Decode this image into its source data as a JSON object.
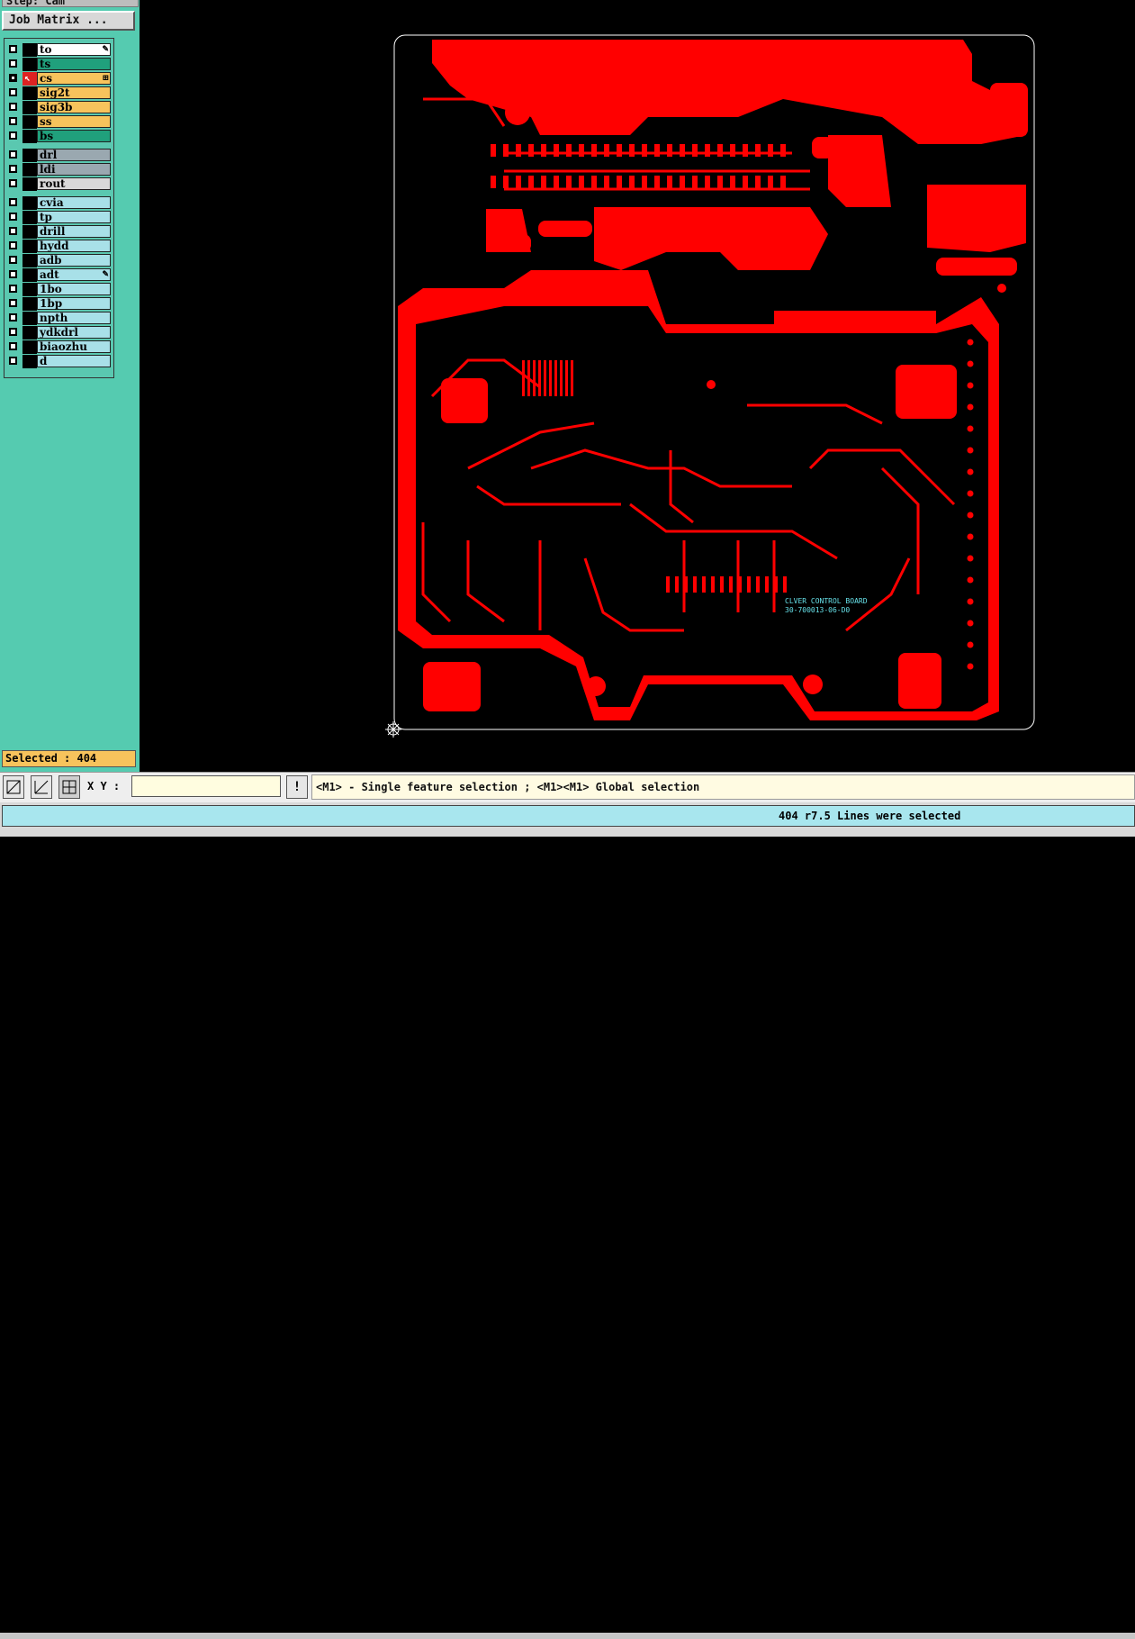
{
  "window": {
    "step_title": "Step: Cam",
    "job_matrix_label": "Job Matrix ..."
  },
  "layers": [
    {
      "name": "to",
      "color": "#ffffff",
      "flag": "✎",
      "checked": false,
      "marker": "none"
    },
    {
      "name": "ts",
      "color": "#20a07c",
      "flag": "",
      "checked": false,
      "marker": "none"
    },
    {
      "name": "cs",
      "color": "#f7c35c",
      "flag": "⊞",
      "checked": true,
      "marker": "arrow"
    },
    {
      "name": "sig2t",
      "color": "#f7c35c",
      "flag": "",
      "checked": false,
      "marker": "none"
    },
    {
      "name": "sig3b",
      "color": "#f7c35c",
      "flag": "",
      "checked": false,
      "marker": "none"
    },
    {
      "name": "ss",
      "color": "#f7c35c",
      "flag": "",
      "checked": false,
      "marker": "none"
    },
    {
      "name": "bs",
      "color": "#20a07c",
      "flag": "",
      "checked": false,
      "marker": "none"
    },
    {
      "name": "drl",
      "color": "#9aa8b0",
      "flag": "",
      "checked": false,
      "marker": "none"
    },
    {
      "name": "ldi",
      "color": "#9aa8b0",
      "flag": "",
      "checked": false,
      "marker": "none"
    },
    {
      "name": "rout",
      "color": "#d9d9d9",
      "flag": "",
      "checked": false,
      "marker": "none"
    },
    {
      "name": "cvia",
      "color": "#a8e0e8",
      "flag": "",
      "checked": false,
      "marker": "none"
    },
    {
      "name": "tp",
      "color": "#a8e0e8",
      "flag": "",
      "checked": false,
      "marker": "none"
    },
    {
      "name": "drill",
      "color": "#a8e0e8",
      "flag": "",
      "checked": false,
      "marker": "none"
    },
    {
      "name": "hydd",
      "color": "#a8e0e8",
      "flag": "",
      "checked": false,
      "marker": "none"
    },
    {
      "name": "adb",
      "color": "#a8e0e8",
      "flag": "",
      "checked": false,
      "marker": "none"
    },
    {
      "name": "adt",
      "color": "#a8e0e8",
      "flag": "✎",
      "checked": false,
      "marker": "none"
    },
    {
      "name": "1bo",
      "color": "#a8e0e8",
      "flag": "",
      "checked": false,
      "marker": "none"
    },
    {
      "name": "1bp",
      "color": "#a8e0e8",
      "flag": "",
      "checked": false,
      "marker": "none"
    },
    {
      "name": "npth",
      "color": "#a8e0e8",
      "flag": "",
      "checked": false,
      "marker": "none"
    },
    {
      "name": "ydkdrl",
      "color": "#a8e0e8",
      "flag": "",
      "checked": false,
      "marker": "none"
    },
    {
      "name": "biaozhu",
      "color": "#a8e0e8",
      "flag": "",
      "checked": false,
      "marker": "none"
    },
    {
      "name": "d",
      "color": "#a8e0e8",
      "flag": "",
      "checked": false,
      "marker": "none"
    }
  ],
  "selection": {
    "label": "Selected : 404"
  },
  "board": {
    "trace_color": "#ff0000",
    "outline_color": "#ffffff",
    "silk_color": "#66e0e8",
    "silk_line1": "CLVER CONTROL BOARD",
    "silk_line2": "30-700013-06-D0"
  },
  "toolbar": {
    "xy_label": "X Y :",
    "xy_value": "",
    "info_label": "!",
    "prompt": "<M1> - Single feature selection ; <M1><M1> Global selection"
  },
  "status": {
    "message": "404 r7.5 Lines were selected"
  },
  "colors": {
    "panel_bg": "#55cbb0",
    "selected_bg": "#f7c35c",
    "status_bg": "#a8e6ee"
  }
}
